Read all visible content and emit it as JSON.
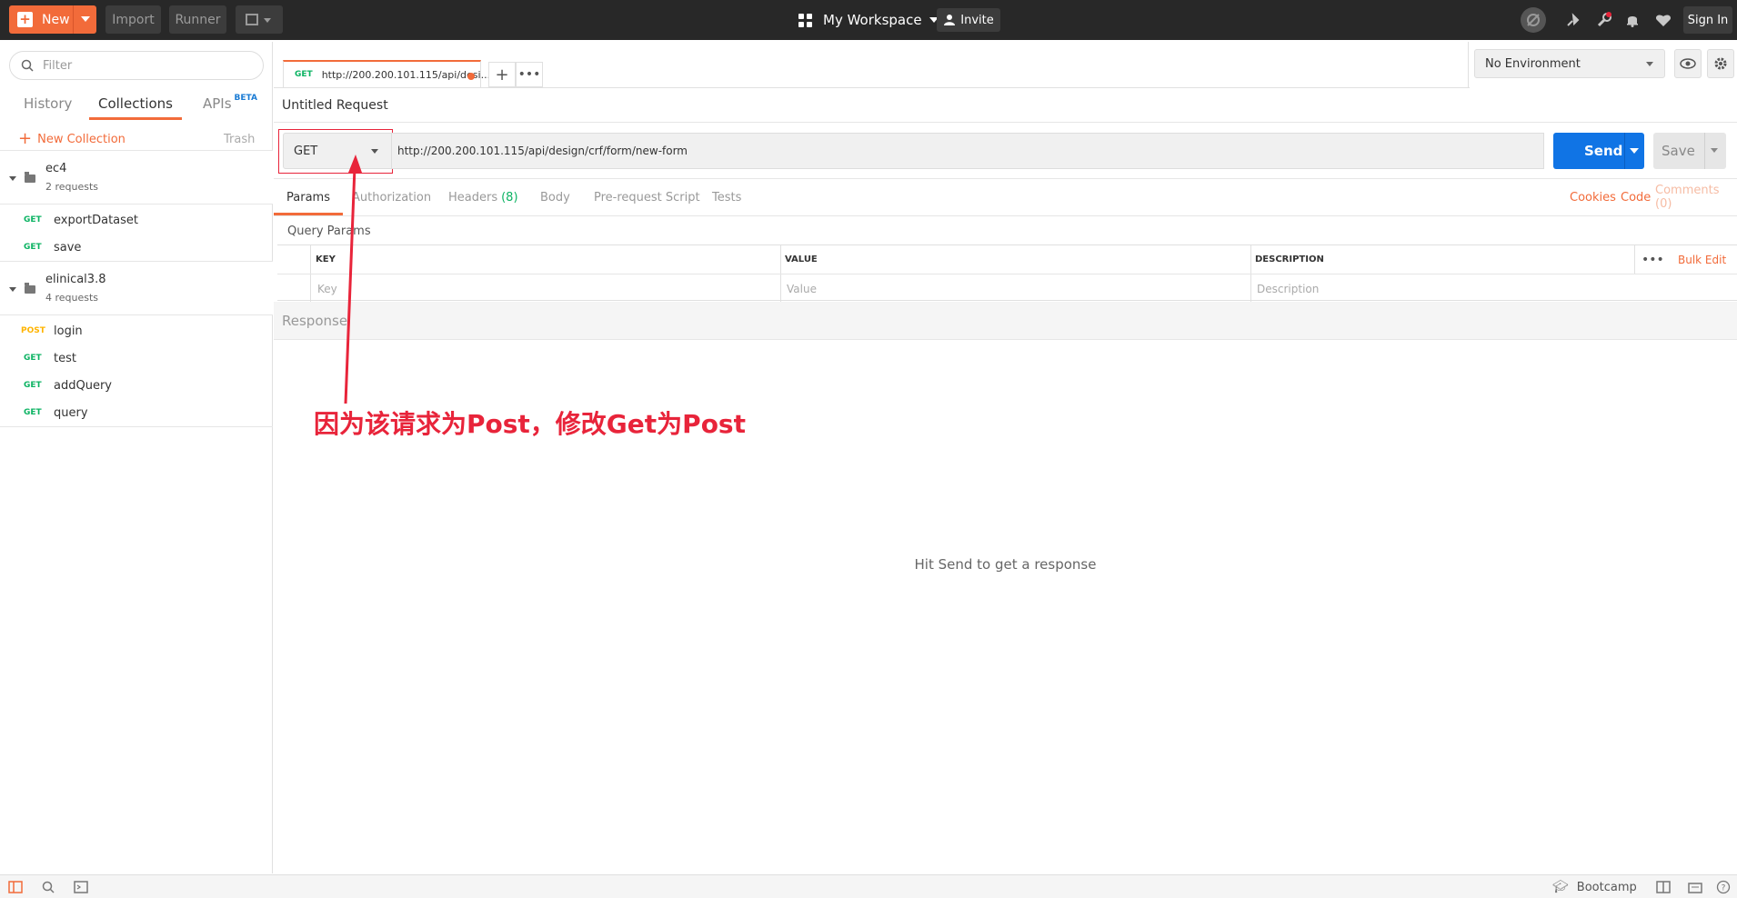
{
  "topbar": {
    "new_label": "New",
    "import_label": "Import",
    "runner_label": "Runner",
    "workspace_label": "My Workspace",
    "invite_label": "Invite",
    "signin_label": "Sign In",
    "icons": [
      "sync-off-icon",
      "satellite-icon",
      "wrench-icon",
      "bell-icon",
      "heart-icon"
    ]
  },
  "sidebar": {
    "filter_placeholder": "Filter",
    "tabs": [
      "History",
      "Collections",
      "APIs"
    ],
    "beta_badge": "BETA",
    "new_collection_label": "New Collection",
    "trash_label": "Trash",
    "collections": [
      {
        "name": "ec4",
        "count": "2 requests",
        "requests": [
          {
            "method": "GET",
            "name": "exportDataset"
          },
          {
            "method": "GET",
            "name": "save"
          }
        ]
      },
      {
        "name": "elinical3.8",
        "count": "4 requests",
        "requests": [
          {
            "method": "POST",
            "name": "login"
          },
          {
            "method": "GET",
            "name": "test"
          },
          {
            "method": "GET",
            "name": "addQuery"
          },
          {
            "method": "GET",
            "name": "query"
          }
        ]
      }
    ]
  },
  "main": {
    "request_tab": {
      "method": "GET",
      "url_short": "http://200.200.101.115/api/desi..."
    },
    "environment": "No Environment",
    "request_name": "Untitled Request",
    "method": "GET",
    "url": "http://200.200.101.115/api/design/crf/form/new-form",
    "send_label": "Send",
    "save_label": "Save",
    "subtabs": {
      "params": "Params",
      "authorization": "Authorization",
      "headers": "Headers",
      "headers_count": "(8)",
      "body": "Body",
      "prerequest": "Pre-request Script",
      "tests": "Tests",
      "cookies": "Cookies",
      "code": "Code",
      "comments": "Comments (0)"
    },
    "query_params": {
      "title": "Query Params",
      "columns": [
        "KEY",
        "VALUE",
        "DESCRIPTION"
      ],
      "placeholders": [
        "Key",
        "Value",
        "Description"
      ],
      "bulk_edit": "Bulk Edit"
    },
    "response_label": "Response",
    "hint": "Hit Send to get a response"
  },
  "annotation": {
    "text": "因为该请求为Post，修改Get为Post",
    "color": "#e8243a"
  },
  "bottombar": {
    "bootcamp_label": "Bootcamp"
  }
}
